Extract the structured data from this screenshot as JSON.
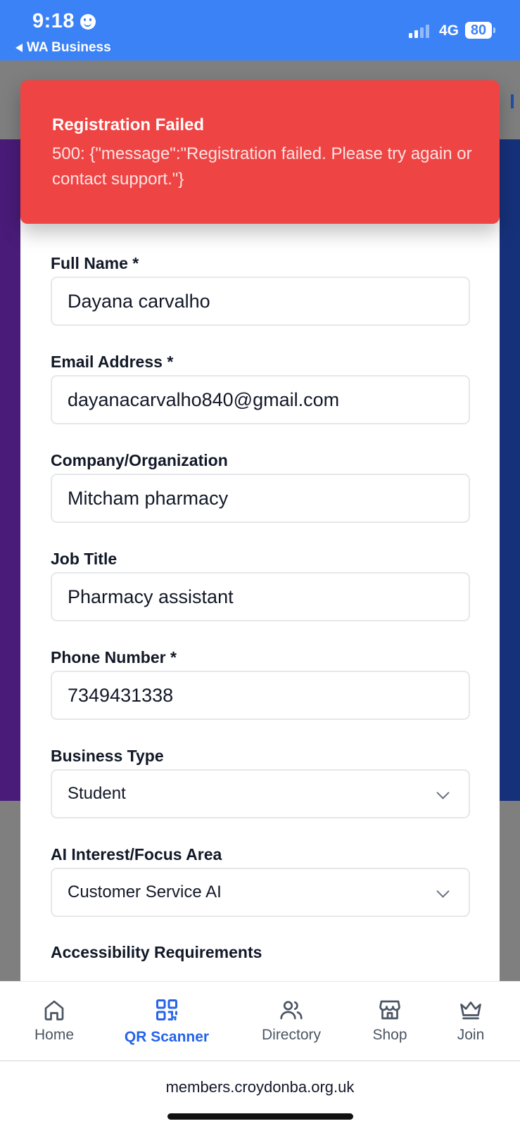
{
  "status_bar": {
    "time": "9:18",
    "back_app": "WA Business",
    "network": "4G",
    "battery": "80",
    "colors": {
      "background": "#3b82f6"
    }
  },
  "toast": {
    "title": "Registration Failed",
    "message": "500: {\"message\":\"Registration failed. Please try again or contact support.\"}",
    "color": "#ef4444"
  },
  "form": {
    "full_name": {
      "label": "Full Name *",
      "value": "Dayana carvalho"
    },
    "email": {
      "label": "Email Address *",
      "value": "dayanacarvalho840@gmail.com"
    },
    "company": {
      "label": "Company/Organization",
      "value": "Mitcham pharmacy"
    },
    "job_title": {
      "label": "Job Title",
      "value": "Pharmacy assistant"
    },
    "phone": {
      "label": "Phone Number *",
      "value": "7349431338"
    },
    "business_type": {
      "label": "Business Type",
      "value": "Student"
    },
    "ai_interest": {
      "label": "AI Interest/Focus Area",
      "value": "Customer Service AI"
    },
    "accessibility": {
      "label": "Accessibility Requirements"
    }
  },
  "nav": {
    "items": [
      {
        "label": "Home",
        "icon": "home-icon"
      },
      {
        "label": "QR Scanner",
        "icon": "qr-code-icon",
        "active": true
      },
      {
        "label": "Directory",
        "icon": "users-icon"
      },
      {
        "label": "Shop",
        "icon": "store-icon"
      },
      {
        "label": "Join",
        "icon": "crown-icon"
      }
    ],
    "active_color": "#2563eb"
  },
  "browser": {
    "url": "members.croydonba.org.uk"
  }
}
